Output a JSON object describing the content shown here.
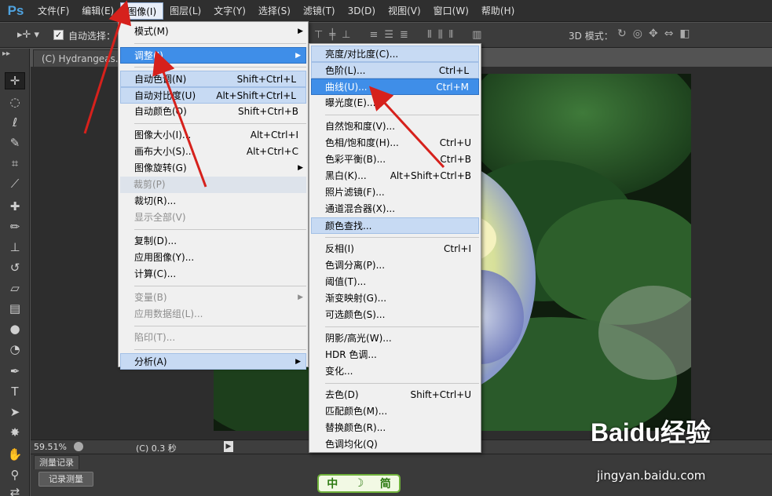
{
  "app": {
    "logo": "Ps"
  },
  "menubar": {
    "items": [
      "文件(F)",
      "编辑(E)",
      "图像(I)",
      "图层(L)",
      "文字(Y)",
      "选择(S)",
      "滤镜(T)",
      "3D(D)",
      "视图(V)",
      "窗口(W)",
      "帮助(H)"
    ],
    "active_index": 2
  },
  "options": {
    "auto_select_label": "自动选择：",
    "auto_select_checked": true,
    "mode_3d_label": "3D 模式："
  },
  "document": {
    "tab_title": "(C) Hydrangeas.jpg"
  },
  "status": {
    "zoom": "59.51%",
    "info": "(C) 0.3 秒",
    "play_glyph": "▶"
  },
  "panel": {
    "tab": "测量记录",
    "record_button": "记录测量"
  },
  "image_menu": {
    "rows": [
      {
        "label": "模式(M)",
        "shortcut": "",
        "submenu": true,
        "state": "normal"
      },
      {
        "sep": true
      },
      {
        "label": "调整(J)",
        "shortcut": "",
        "submenu": true,
        "state": "hlblue"
      },
      {
        "sep": true
      },
      {
        "label": "自动色调(N)",
        "shortcut": "Shift+Ctrl+L",
        "submenu": false,
        "state": "hl"
      },
      {
        "label": "自动对比度(U)",
        "shortcut": "Alt+Shift+Ctrl+L",
        "submenu": false,
        "state": "hl"
      },
      {
        "label": "自动颜色(O)",
        "shortcut": "Shift+Ctrl+B",
        "submenu": false,
        "state": "normal"
      },
      {
        "sep": true
      },
      {
        "label": "图像大小(I)...",
        "shortcut": "Alt+Ctrl+I",
        "submenu": false,
        "state": "normal"
      },
      {
        "label": "画布大小(S)...",
        "shortcut": "Alt+Ctrl+C",
        "submenu": false,
        "state": "normal"
      },
      {
        "label": "图像旋转(G)",
        "shortcut": "",
        "submenu": true,
        "state": "normal"
      },
      {
        "label": "裁剪(P)",
        "shortcut": "",
        "submenu": false,
        "state": "disabled-dim"
      },
      {
        "label": "裁切(R)...",
        "shortcut": "",
        "submenu": false,
        "state": "normal"
      },
      {
        "label": "显示全部(V)",
        "shortcut": "",
        "submenu": false,
        "state": "disabled"
      },
      {
        "sep": true
      },
      {
        "label": "复制(D)...",
        "shortcut": "",
        "submenu": false,
        "state": "normal"
      },
      {
        "label": "应用图像(Y)...",
        "shortcut": "",
        "submenu": false,
        "state": "normal"
      },
      {
        "label": "计算(C)...",
        "shortcut": "",
        "submenu": false,
        "state": "normal"
      },
      {
        "sep": true
      },
      {
        "label": "变量(B)",
        "shortcut": "",
        "submenu": true,
        "state": "disabled"
      },
      {
        "label": "应用数据组(L)...",
        "shortcut": "",
        "submenu": false,
        "state": "disabled"
      },
      {
        "sep": true
      },
      {
        "label": "陷印(T)...",
        "shortcut": "",
        "submenu": false,
        "state": "disabled"
      },
      {
        "sep": true
      },
      {
        "label": "分析(A)",
        "shortcut": "",
        "submenu": true,
        "state": "hl"
      }
    ]
  },
  "adjust_menu": {
    "rows": [
      {
        "label": "亮度/对比度(C)...",
        "shortcut": "",
        "state": "hl"
      },
      {
        "label": "色阶(L)...",
        "shortcut": "Ctrl+L",
        "state": "hl"
      },
      {
        "label": "曲线(U)...",
        "shortcut": "Ctrl+M",
        "state": "hlblue"
      },
      {
        "label": "曝光度(E)...",
        "shortcut": "",
        "state": "normal"
      },
      {
        "sep": true
      },
      {
        "label": "自然饱和度(V)...",
        "shortcut": "",
        "state": "normal"
      },
      {
        "label": "色相/饱和度(H)...",
        "shortcut": "Ctrl+U",
        "state": "normal"
      },
      {
        "label": "色彩平衡(B)...",
        "shortcut": "Ctrl+B",
        "state": "normal"
      },
      {
        "label": "黑白(K)...",
        "shortcut": "Alt+Shift+Ctrl+B",
        "state": "normal"
      },
      {
        "label": "照片滤镜(F)...",
        "shortcut": "",
        "state": "normal"
      },
      {
        "label": "通道混合器(X)...",
        "shortcut": "",
        "state": "normal"
      },
      {
        "label": "颜色查找...",
        "shortcut": "",
        "state": "hl"
      },
      {
        "sep": true
      },
      {
        "label": "反相(I)",
        "shortcut": "Ctrl+I",
        "state": "normal"
      },
      {
        "label": "色调分离(P)...",
        "shortcut": "",
        "state": "normal"
      },
      {
        "label": "阈值(T)...",
        "shortcut": "",
        "state": "normal"
      },
      {
        "label": "渐变映射(G)...",
        "shortcut": "",
        "state": "normal"
      },
      {
        "label": "可选颜色(S)...",
        "shortcut": "",
        "state": "normal"
      },
      {
        "sep": true
      },
      {
        "label": "阴影/高光(W)...",
        "shortcut": "",
        "state": "normal"
      },
      {
        "label": "HDR 色调...",
        "shortcut": "",
        "state": "normal"
      },
      {
        "label": "变化...",
        "shortcut": "",
        "state": "normal"
      },
      {
        "sep": true
      },
      {
        "label": "去色(D)",
        "shortcut": "Shift+Ctrl+U",
        "state": "normal"
      },
      {
        "label": "匹配颜色(M)...",
        "shortcut": "",
        "state": "normal"
      },
      {
        "label": "替换颜色(R)...",
        "shortcut": "",
        "state": "normal"
      },
      {
        "label": "色调均化(Q)",
        "shortcut": "",
        "state": "normal"
      }
    ]
  },
  "watermark": {
    "logo": "Baidu经验",
    "url": "jingyan.baidu.com"
  },
  "ime_tag": {
    "left": "中",
    "right": "简"
  },
  "colors": {
    "arrow": "#d6211c",
    "menu_highlight": "#3f8ee8",
    "menu_soft_highlight": "#c7daf3"
  }
}
